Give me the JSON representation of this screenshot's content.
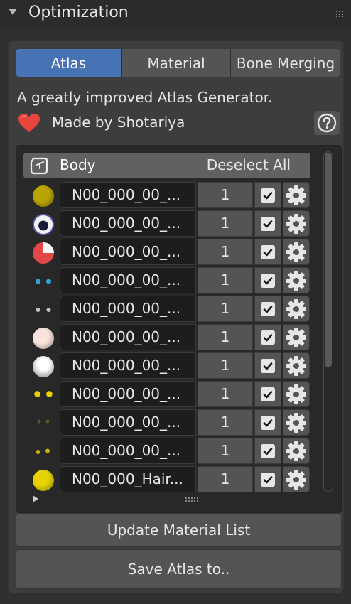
{
  "panel": {
    "title": "Optimization"
  },
  "tabs": [
    {
      "label": "Atlas",
      "active": true
    },
    {
      "label": "Material",
      "active": false
    },
    {
      "label": "Bone Merging",
      "active": false
    }
  ],
  "info": {
    "description": "A greatly improved Atlas Generator.",
    "credit": "Made by Shotariya",
    "help_icon": "question-icon",
    "heart_icon": "heart-icon"
  },
  "mesh": {
    "name": "Body",
    "deselect_label": "Deselect All"
  },
  "materials": [
    {
      "name": "N00_000_00_...",
      "value": "1",
      "checked": true,
      "thumb": "#b8a500"
    },
    {
      "name": "N00_000_00_...",
      "value": "1",
      "checked": true,
      "thumb": "eyebrow"
    },
    {
      "name": "N00_000_00_...",
      "value": "1",
      "checked": true,
      "thumb": "red-white"
    },
    {
      "name": "N00_000_00_...",
      "value": "1",
      "checked": true,
      "thumb": "dark-blue"
    },
    {
      "name": "N00_000_00_...",
      "value": "1",
      "checked": true,
      "thumb": "dark"
    },
    {
      "name": "N00_000_00_...",
      "value": "1",
      "checked": true,
      "thumb": "#f8e4dc"
    },
    {
      "name": "N00_000_00_...",
      "value": "1",
      "checked": true,
      "thumb": "grey-white"
    },
    {
      "name": "N00_000_00_...",
      "value": "1",
      "checked": true,
      "thumb": "yellow-mark"
    },
    {
      "name": "N00_000_00_...",
      "value": "1",
      "checked": true,
      "thumb": "dark-faint"
    },
    {
      "name": "N00_000_00_...",
      "value": "1",
      "checked": true,
      "thumb": "yellow-dots"
    },
    {
      "name": "N00_000_Hair...",
      "value": "1",
      "checked": true,
      "thumb": "#e6d400"
    }
  ],
  "buttons": {
    "update": "Update Material List",
    "save": "Save Atlas to.."
  },
  "colors": {
    "accent": "#4772b3",
    "background": "#303030",
    "panel": "#3d3d3d",
    "heart": "#e8453c"
  }
}
